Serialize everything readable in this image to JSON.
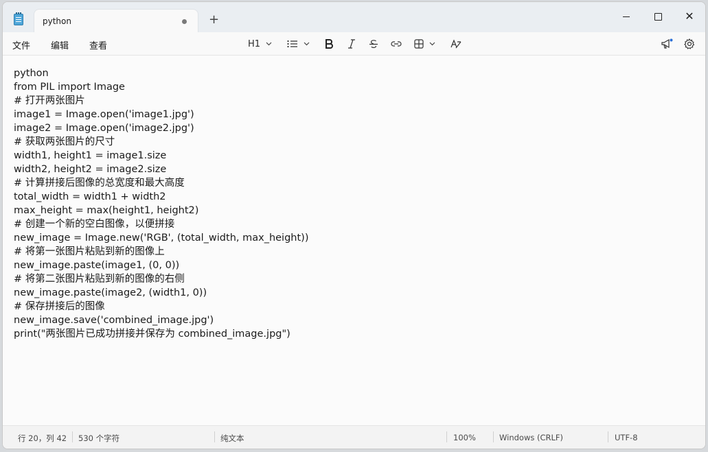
{
  "tab": {
    "title": "python"
  },
  "titlebar": {
    "new_tab_label": "+"
  },
  "menu": [
    "文件",
    "编辑",
    "查看"
  ],
  "toolbar": {
    "heading_label": "H1"
  },
  "editor": {
    "lines": [
      "python",
      "from PIL import Image",
      "# 打开两张图片",
      "image1 = Image.open('image1.jpg')",
      "image2 = Image.open('image2.jpg')",
      "# 获取两张图片的尺寸",
      "width1, height1 = image1.size",
      "width2, height2 = image2.size",
      "# 计算拼接后图像的总宽度和最大高度",
      "total_width = width1 + width2",
      "max_height = max(height1, height2)",
      "# 创建一个新的空白图像，以便拼接",
      "new_image = Image.new('RGB', (total_width, max_height))",
      "# 将第一张图片粘贴到新的图像上",
      "new_image.paste(image1, (0, 0))",
      "# 将第二张图片粘贴到新的图像的右侧",
      "new_image.paste(image2, (width1, 0))",
      "# 保存拼接后的图像",
      "new_image.save('combined_image.jpg')",
      "print(\"两张图片已成功拼接并保存为 combined_image.jpg\")"
    ]
  },
  "status": {
    "position": "行 20，列 42",
    "char_count": "530 个字符",
    "format": "纯文本",
    "zoom": "100%",
    "line_ending": "Windows (CRLF)",
    "encoding": "UTF-8"
  },
  "colors": {
    "titlebar_bg": "#eaeef2",
    "editor_bg": "#fbfbfb",
    "accent": "#4ea6d9",
    "notification_dot": "#2b6fd6"
  }
}
